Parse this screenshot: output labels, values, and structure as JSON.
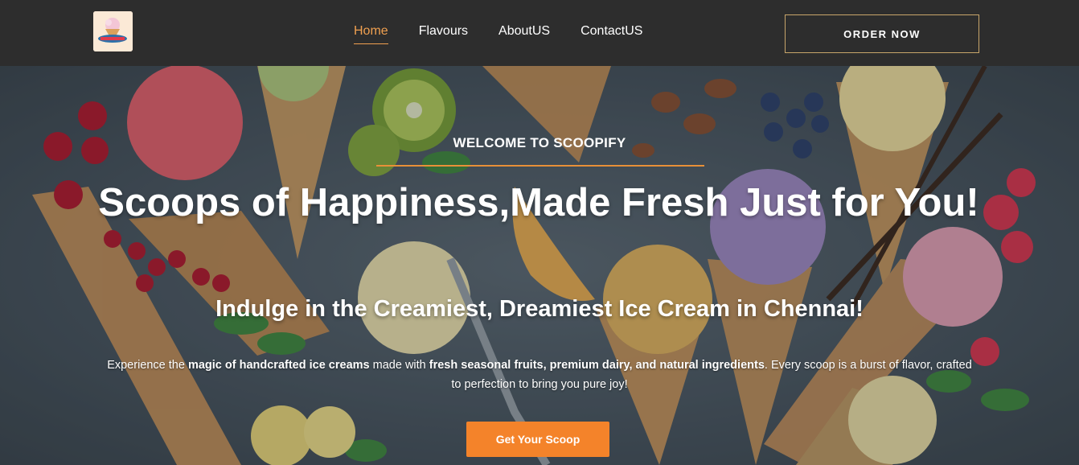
{
  "header": {
    "logo_alt": "Scoopify logo",
    "nav": [
      {
        "label": "Home",
        "active": true
      },
      {
        "label": "Flavours",
        "active": false
      },
      {
        "label": "AboutUS",
        "active": false
      },
      {
        "label": "ContactUS",
        "active": false
      }
    ],
    "order_label": "ORDER NOW"
  },
  "hero": {
    "welcome": "WELCOME TO SCOOPIFY",
    "headline": "Scoops of Happiness,Made Fresh Just for You!",
    "subheadline": "Indulge in the Creamiest, Dreamiest Ice Cream in Chennai!",
    "description": {
      "p1": "Experience the ",
      "b1": "magic of handcrafted ice creams",
      "p2": " made with ",
      "b2": "fresh seasonal fruits, premium dairy, and natural ingredients",
      "p3": ". Every scoop is a burst of flavor, crafted to perfection to bring you pure joy!"
    },
    "cta_label": "Get Your Scoop"
  },
  "colors": {
    "header_bg": "#2d2d2d",
    "accent": "#f0a050",
    "cta_bg": "#f4832a",
    "order_border": "#c8a56a"
  }
}
